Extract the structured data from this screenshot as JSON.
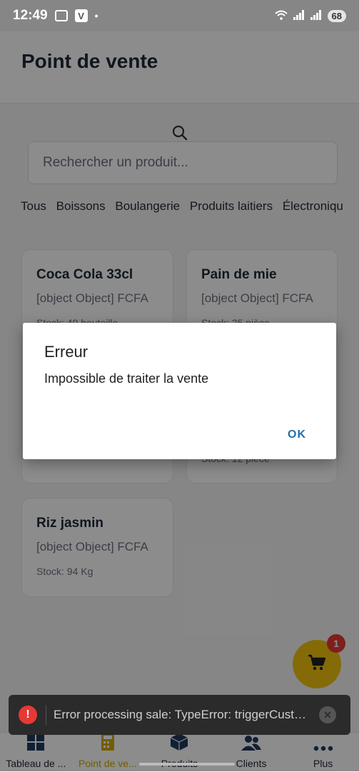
{
  "status": {
    "time": "12:49",
    "battery": "68"
  },
  "header": {
    "title": "Point de vente"
  },
  "search": {
    "placeholder": "Rechercher un produit..."
  },
  "categories": [
    "Tous",
    "Boissons",
    "Boulangerie",
    "Produits laitiers",
    "Électroniqu"
  ],
  "products": [
    {
      "name": "Coca Cola 33cl",
      "price": "[object Object] FCFA",
      "stock": "Stock: 49 bouteille"
    },
    {
      "name": "Pain de mie",
      "price": "[object Object] FCFA",
      "stock": "Stock: 25 pièce"
    },
    {
      "name": "Riz jasmin",
      "price": "[object Object] FCFA",
      "stock": "Stock: 94 Kg"
    }
  ],
  "hidden_stock": "Stock: 12 pièce",
  "cart": {
    "count": "1"
  },
  "dialog": {
    "title": "Erreur",
    "message": "Impossible de traiter la vente",
    "ok": "OK"
  },
  "toast": {
    "text": "Error processing sale: TypeError: triggerCusto..."
  },
  "nav": {
    "items": [
      {
        "label": "Tableau de ...",
        "icon": "grid-icon"
      },
      {
        "label": "Point de ve...",
        "icon": "calculator-icon"
      },
      {
        "label": "Produits",
        "icon": "box-icon"
      },
      {
        "label": "Clients",
        "icon": "users-icon"
      },
      {
        "label": "Plus",
        "icon": "more-icon"
      }
    ]
  },
  "colors": {
    "accent": "#f1c40f",
    "active_nav": "#d4a800",
    "error": "#e53935",
    "dialog_button": "#1e6fb0"
  }
}
